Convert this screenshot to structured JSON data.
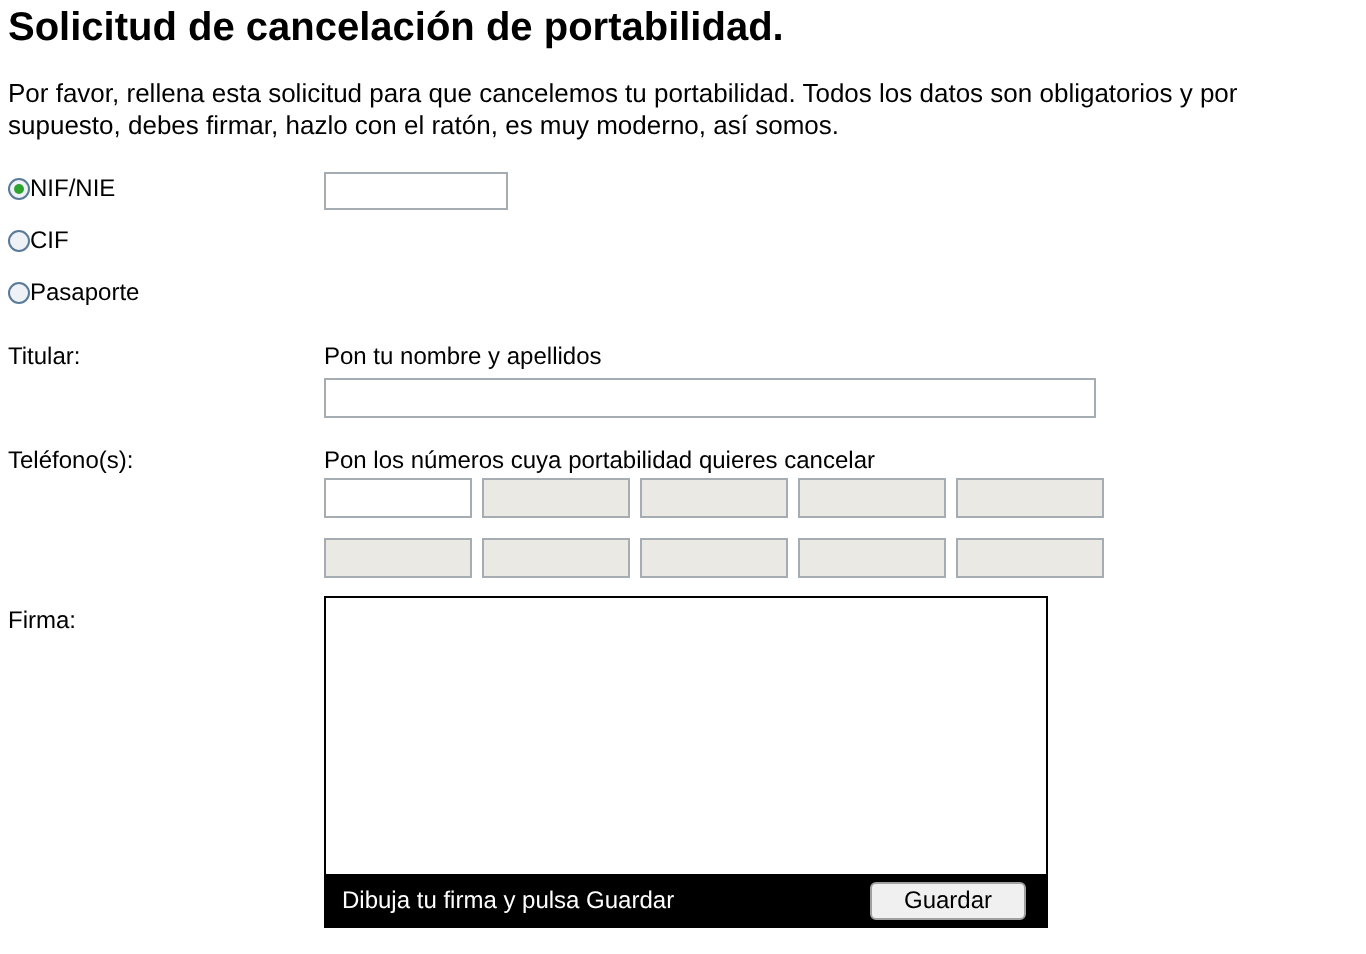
{
  "title": "Solicitud de cancelación de portabilidad.",
  "intro": "Por favor, rellena esta solicitud para que cancelemos tu portabilidad. Todos los datos son obligatorios y por supuesto, debes firmar, hazlo con el ratón, es muy moderno, así somos.",
  "id_types": [
    {
      "label": "NIF/NIE",
      "selected": true
    },
    {
      "label": "CIF",
      "selected": false
    },
    {
      "label": "Pasaporte",
      "selected": false
    }
  ],
  "holder": {
    "label": "Titular:",
    "hint": "Pon tu nombre y apellidos"
  },
  "phones": {
    "label": "Teléfono(s):",
    "hint": "Pon los números cuya portabilidad quieres cancelar",
    "fields": [
      {
        "disabled": false
      },
      {
        "disabled": true
      },
      {
        "disabled": true
      },
      {
        "disabled": true
      },
      {
        "disabled": true
      },
      {
        "disabled": true
      },
      {
        "disabled": true
      },
      {
        "disabled": true
      },
      {
        "disabled": true
      },
      {
        "disabled": true
      }
    ]
  },
  "signature": {
    "label": "Firma:",
    "instruction": "Dibuja tu firma y pulsa Guardar",
    "button": "Guardar"
  }
}
